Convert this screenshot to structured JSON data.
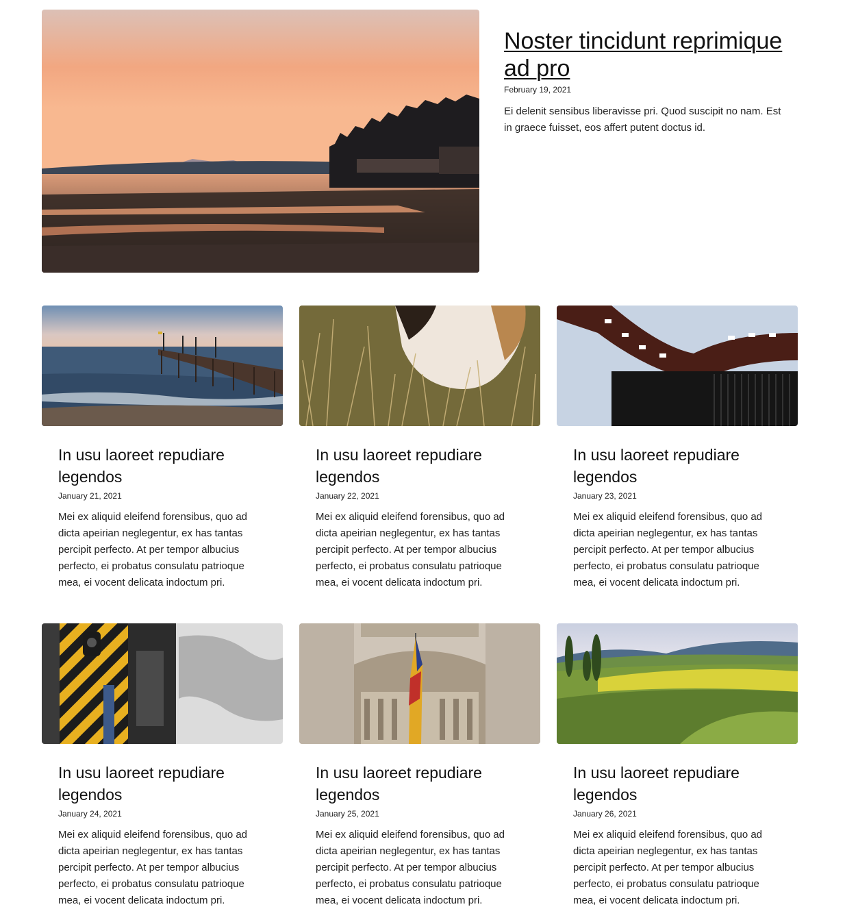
{
  "featured": {
    "title": "Noster tincidunt reprimique ad pro",
    "date": "February 19, 2021",
    "excerpt": "Ei delenit sensibus liberavisse pri. Quod suscipit no nam. Est in graece fuisset, eos affert putent doctus id.",
    "image": "sunset-beach-photo"
  },
  "posts": [
    {
      "title": "In usu laoreet repudiare legendos",
      "date": "January 21, 2021",
      "excerpt": "Mei ex aliquid eleifend forensibus, quo ad dicta apeirian neglegentur, ex has tantas percipit perfecto. At per tempor albucius perfecto, ei probatus consulatu patrioque mea, ei vocent delicata indoctum pri.",
      "image": "pier-ocean-photo"
    },
    {
      "title": "In usu laoreet repudiare legendos",
      "date": "January 22, 2021",
      "excerpt": "Mei ex aliquid eleifend forensibus, quo ad dicta apeirian neglegentur, ex has tantas percipit perfecto. At per tempor albucius perfecto, ei probatus consulatu patrioque mea, ei vocent delicata indoctum pri.",
      "image": "dog-in-grass-photo"
    },
    {
      "title": "In usu laoreet repudiare legendos",
      "date": "January 23, 2021",
      "excerpt": "Mei ex aliquid eleifend forensibus, quo ad dicta apeirian neglegentur, ex has tantas percipit perfecto. At per tempor albucius perfecto, ei probatus consulatu patrioque mea, ei vocent delicata indoctum pri.",
      "image": "film-camera-lens-photo"
    },
    {
      "title": "In usu laoreet repudiare legendos",
      "date": "January 24, 2021",
      "excerpt": "Mei ex aliquid eleifend forensibus, quo ad dicta apeirian neglegentur, ex has tantas percipit perfecto. At per tempor albucius perfecto, ei probatus consulatu patrioque mea, ei vocent delicata indoctum pri.",
      "image": "train-door-photo"
    },
    {
      "title": "In usu laoreet repudiare legendos",
      "date": "January 25, 2021",
      "excerpt": "Mei ex aliquid eleifend forensibus, quo ad dicta apeirian neglegentur, ex has tantas percipit perfecto. At per tempor albucius perfecto, ei probatus consulatu patrioque mea, ei vocent delicata indoctum pri.",
      "image": "gothic-tower-flag-photo"
    },
    {
      "title": "In usu laoreet repudiare legendos",
      "date": "January 26, 2021",
      "excerpt": "Mei ex aliquid eleifend forensibus, quo ad dicta apeirian neglegentur, ex has tantas percipit perfecto. At per tempor albucius perfecto, ei probatus consulatu patrioque mea, ei vocent delicata indoctum pri.",
      "image": "green-hills-landscape-photo"
    }
  ]
}
